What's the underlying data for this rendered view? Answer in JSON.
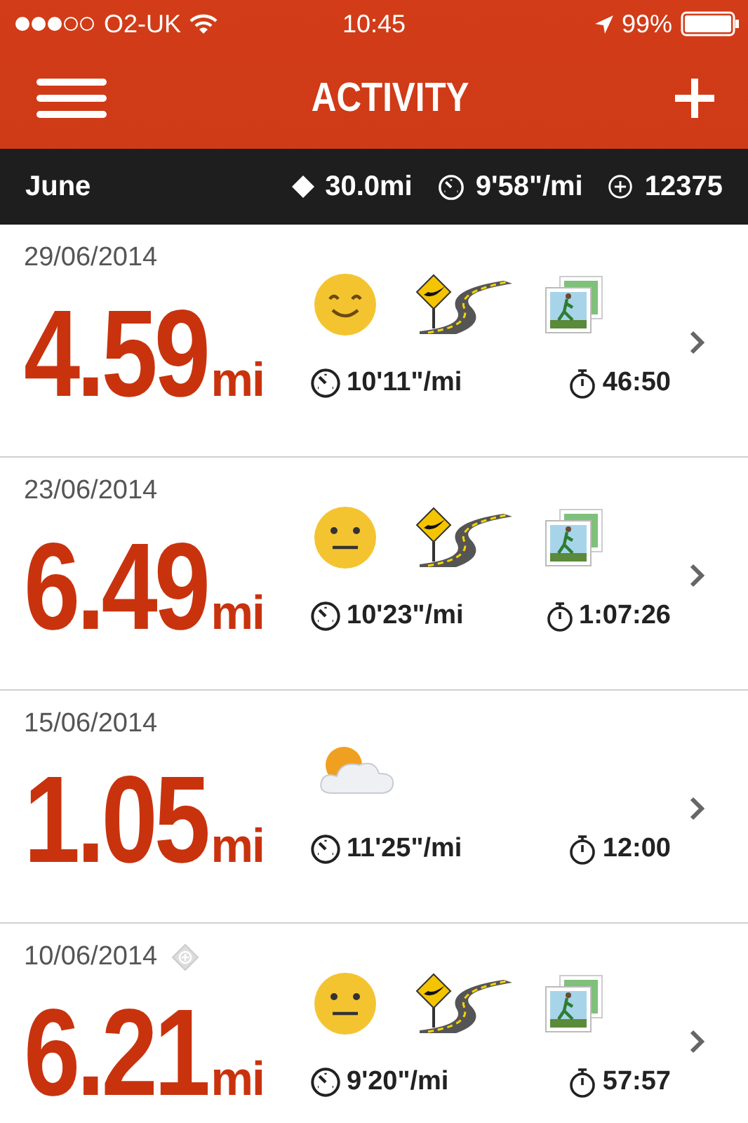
{
  "status_bar": {
    "carrier": "O2-UK",
    "time": "10:45",
    "battery": "99%"
  },
  "header": {
    "title": "ACTIVITY"
  },
  "summary": {
    "month": "June",
    "distance": "30.0mi",
    "pace": "9'58\"/mi",
    "fuel": "12375"
  },
  "runs": [
    {
      "date": "29/06/2014",
      "tagged": false,
      "distance": "4.59",
      "unit": "mi",
      "icons": [
        {
          "kind": "happy"
        },
        {
          "kind": "road"
        },
        {
          "kind": "photo"
        }
      ],
      "pace": "10'11\"/mi",
      "duration": "46:50"
    },
    {
      "date": "23/06/2014",
      "tagged": false,
      "distance": "6.49",
      "unit": "mi",
      "icons": [
        {
          "kind": "neutral"
        },
        {
          "kind": "road"
        },
        {
          "kind": "photo"
        }
      ],
      "pace": "10'23\"/mi",
      "duration": "1:07:26"
    },
    {
      "date": "15/06/2014",
      "tagged": false,
      "distance": "1.05",
      "unit": "mi",
      "icons": [
        {
          "kind": "weather"
        }
      ],
      "pace": "11'25\"/mi",
      "duration": "12:00"
    },
    {
      "date": "10/06/2014",
      "tagged": true,
      "distance": "6.21",
      "unit": "mi",
      "icons": [
        {
          "kind": "neutral"
        },
        {
          "kind": "road"
        },
        {
          "kind": "photo"
        }
      ],
      "pace": "9'20\"/mi",
      "duration": "57:57"
    }
  ]
}
